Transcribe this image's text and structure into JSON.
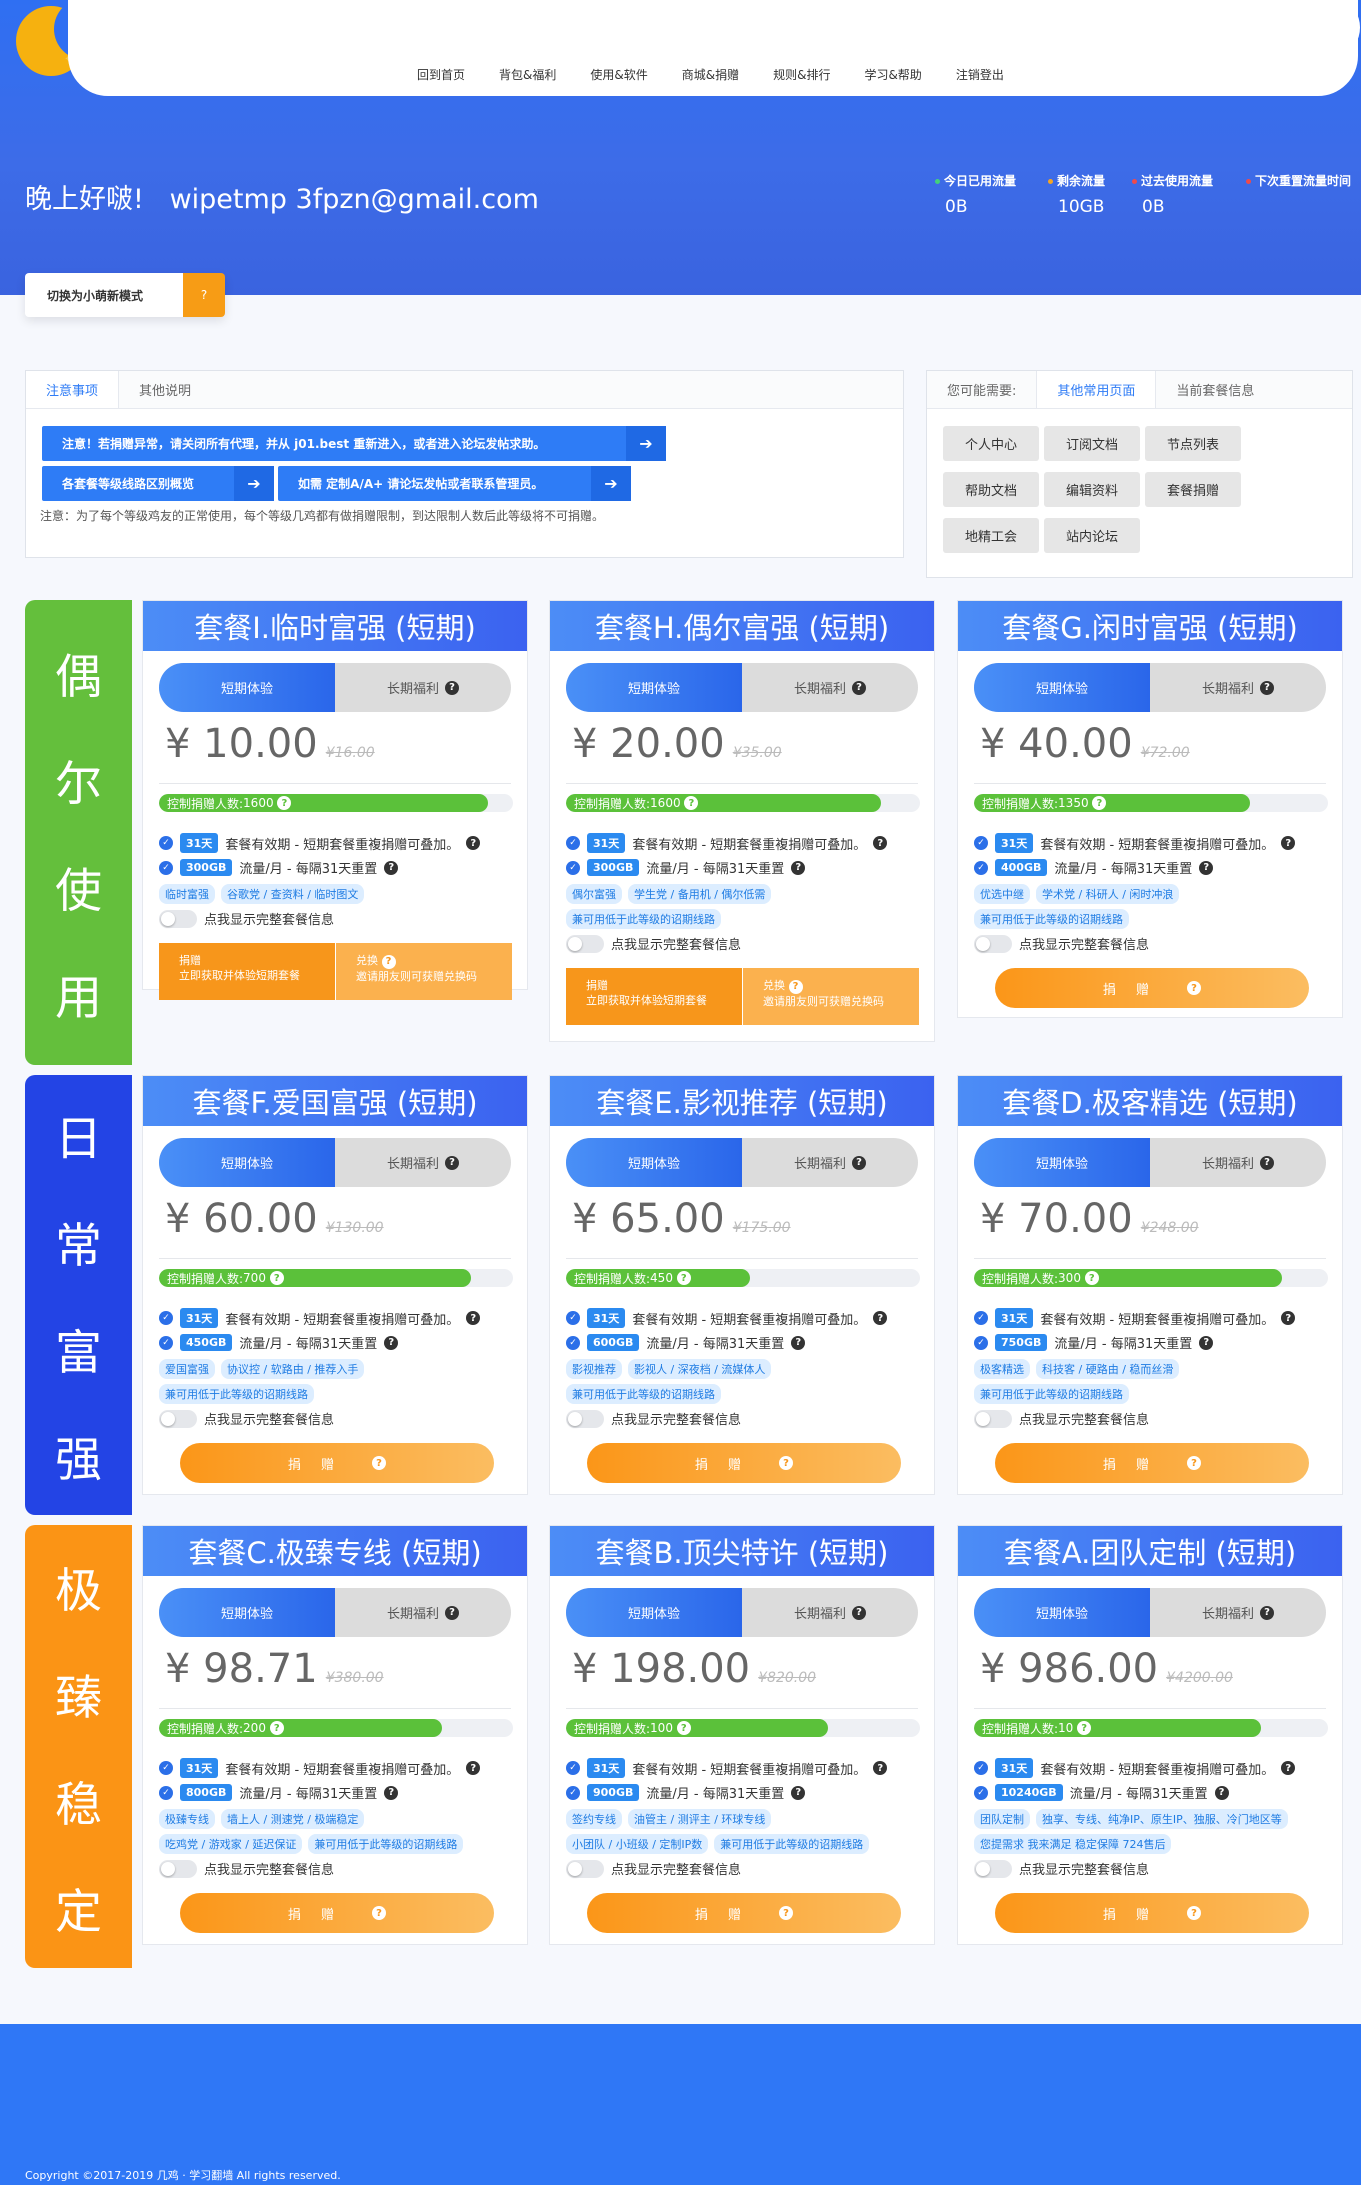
{
  "nav": {
    "items": [
      "回到首页",
      "背包&福利",
      "使用&软件",
      "商城&捐赠",
      "规则&排行",
      "学习&帮助",
      "注销登出"
    ]
  },
  "greeting": {
    "prefix": "晚上好啵!",
    "email": "wipetmp 3fpzn@gmail.com"
  },
  "traffic": [
    {
      "label": "今日已用流量",
      "value": "0B",
      "color": "#43d17a"
    },
    {
      "label": "剩余流量",
      "value": "10GB",
      "color": "#f5a623"
    },
    {
      "label": "过去使用流量",
      "value": "0B",
      "color": "#f04a4a"
    },
    {
      "label": "下次重置流量时间",
      "value": "",
      "color": "#f04a4a"
    }
  ],
  "mode_switch": {
    "label": "切换为小萌新模式"
  },
  "notice_panel": {
    "tabs": [
      "注意事项",
      "其他说明"
    ],
    "btn1": "注意！若捐赠异常，请关闭所有代理，并从 j01.best 重新进入，或者进入论坛发帖求助。",
    "btn2": "各套餐等级线路区别概览",
    "btn3": "如需 定制A/A+ 请论坛发帖或者联系管理员。",
    "note": "注意：为了每个等级鸡友的正常使用，每个等级几鸡都有做捐赠限制，到达限制人数后此等级将不可捐赠。"
  },
  "links_panel": {
    "tabs": [
      "您可能需要:",
      "其他常用页面",
      "当前套餐信息"
    ],
    "buttons": [
      "个人中心",
      "订阅文档",
      "节点列表",
      "帮助文档",
      "编辑资料",
      "套餐捐赠",
      "地精工会",
      "站内论坛"
    ]
  },
  "categories": [
    {
      "chars": [
        "偶",
        "尔",
        "使",
        "用"
      ],
      "color": "#64bf3c"
    },
    {
      "chars": [
        "日",
        "常",
        "富",
        "强"
      ],
      "color": "#2344e5"
    },
    {
      "chars": [
        "极",
        "臻",
        "稳",
        "定"
      ],
      "color": "#fb9415"
    }
  ],
  "plan_common": {
    "tab_short": "短期体验",
    "tab_long": "长期福利",
    "currency": "¥",
    "limit_prefix": "控制捐赠人数: ",
    "days": "31天",
    "days_text": "套餐有效期 - 短期套餐重複捐赠可叠加。",
    "flow_text": "流量/月 - 每隔31天重置",
    "toggle_text": "点我显示完整套餐信息",
    "donate_text": "捐 赠",
    "dual_a1": "捐赠",
    "dual_a2": "立即获取并体验短期套餐",
    "dual_b1": "兑换",
    "dual_b2": "邀请朋友则可获赠兑换码",
    "lower_tag": "兼可用低于此等级的诏期线路"
  },
  "plans": [
    {
      "title": "套餐I.临时富强 (短期)",
      "price": "10.00",
      "orig": "¥16.00",
      "limit": "1600",
      "fill": 0.93,
      "flow": "300GB",
      "tags": [
        "临时富强",
        "谷歌党 / 查资料 / 临时图文"
      ],
      "lower": false,
      "style": "dual"
    },
    {
      "title": "套餐H.偶尔富强 (短期)",
      "price": "20.00",
      "orig": "¥35.00",
      "limit": "1600",
      "fill": 0.89,
      "flow": "300GB",
      "tags": [
        "偶尔富强",
        "学生党 / 备用机 / 偶尔低需"
      ],
      "lower": true,
      "style": "dual"
    },
    {
      "title": "套餐G.闲时富强 (短期)",
      "price": "40.00",
      "orig": "¥72.00",
      "limit": "1350",
      "fill": 0.78,
      "flow": "400GB",
      "tags": [
        "优选中继",
        "学术党 / 科研人 / 闲时冲浪"
      ],
      "lower": true,
      "style": "donate"
    },
    {
      "title": "套餐F.爱国富强 (短期)",
      "price": "60.00",
      "orig": "¥130.00",
      "limit": "700",
      "fill": 0.88,
      "flow": "450GB",
      "tags": [
        "爱国富强",
        "协议控 / 软路由 / 推荐入手"
      ],
      "lower": true,
      "style": "donate"
    },
    {
      "title": "套餐E.影视推荐 (短期)",
      "price": "65.00",
      "orig": "¥175.00",
      "limit": "450",
      "fill": 0.52,
      "flow": "600GB",
      "tags": [
        "影视推荐",
        "影视人 / 深夜档 / 流媒体人"
      ],
      "lower": true,
      "style": "donate"
    },
    {
      "title": "套餐D.极客精选 (短期)",
      "price": "70.00",
      "orig": "¥248.00",
      "limit": "300",
      "fill": 0.87,
      "flow": "750GB",
      "tags": [
        "极客精选",
        "科技客 / 硬路由 / 稳而丝滑"
      ],
      "lower": true,
      "style": "donate"
    },
    {
      "title": "套餐C.极臻专线 (短期)",
      "price": "98.71",
      "orig": "¥380.00",
      "limit": "200",
      "fill": 0.8,
      "flow": "800GB",
      "tags": [
        "极臻专线",
        "墙上人 / 测速党 / 极端稳定"
      ],
      "tags2": [
        "吃鸡党 / 游戏家 / 延迟保证",
        "兼可用低于此等级的诏期线路"
      ],
      "lower": false,
      "style": "donate"
    },
    {
      "title": "套餐B.顶尖特许 (短期)",
      "price": "198.00",
      "orig": "¥820.00",
      "limit": "100",
      "fill": 0.74,
      "flow": "900GB",
      "tags": [
        "签约专线",
        "油管主 / 测评主 / 环球专线"
      ],
      "tags2": [
        "小团队 / 小班级 / 定制IP数",
        "兼可用低于此等级的诏期线路"
      ],
      "lower": false,
      "style": "donate"
    },
    {
      "title": "套餐A.团队定制 (短期)",
      "price": "986.00",
      "orig": "¥4200.00",
      "limit": "10",
      "fill": 0.81,
      "flow": "10240GB",
      "tags": [
        "团队定制",
        "独享、专线、纯净IP、原生IP、独服、冷门地区等"
      ],
      "tags2": [
        "您提需求 我来满足 稳定保障 724售后"
      ],
      "lower": false,
      "style": "donate"
    }
  ],
  "footer": {
    "copyright": "Copyright ©2017-2019 几鸡 · 学习翻墙 All rights reserved."
  }
}
